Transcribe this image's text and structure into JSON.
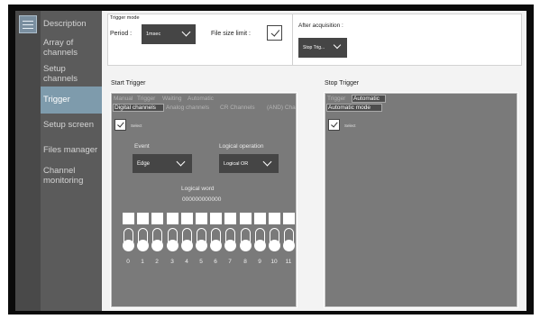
{
  "sidebar": {
    "menu_icon": "hamburger-menu-icon",
    "items": [
      {
        "label": "Description"
      },
      {
        "label": "Array of\nchannels"
      },
      {
        "label": "Setup\nchannels"
      },
      {
        "label": "Trigger",
        "active": true
      },
      {
        "label": "Setup screen"
      },
      {
        "label": "Files manager"
      },
      {
        "label": "Channel\nmonitoring"
      }
    ]
  },
  "trigger_mode": {
    "title": "Trigger mode",
    "period_label": "Period :",
    "period_value": "1msec",
    "file_size_label": "File size limit :",
    "file_size_checked": true,
    "after_acq_label": "After acquisition :",
    "after_acq_value": "Stop Trig..."
  },
  "start_trigger": {
    "title": "Start Trigger",
    "mode_tabs": [
      {
        "label": "Manual",
        "on": false
      },
      {
        "label": "Trigger",
        "on": false
      },
      {
        "label": "Waiting",
        "on": false
      },
      {
        "label": "Automatic",
        "on": false
      }
    ],
    "source_tabs": [
      {
        "label": "Digital channels",
        "on": true
      },
      {
        "label": "Analog channels",
        "on": false
      },
      {
        "label": "CR Channels",
        "on": false
      },
      {
        "label": "(AND) Chann",
        "on": false
      }
    ],
    "select_label": "Select",
    "select_checked": true,
    "event_label": "Event",
    "event_value": "Edge",
    "logic_label": "Logical operation",
    "logic_value": "Logical OR",
    "word_label": "Logical word",
    "word_value": "000000000000",
    "bits": [
      "0",
      "1",
      "2",
      "3",
      "4",
      "5",
      "6",
      "7",
      "8",
      "9",
      "10",
      "11"
    ]
  },
  "stop_trigger": {
    "title": "Stop Trigger",
    "tabs": [
      {
        "label": "Trigger",
        "on": false
      },
      {
        "label": "Automatic",
        "on": true
      }
    ],
    "mode_label": "Automatic mode",
    "select_label": "Select",
    "select_checked": true
  },
  "colors": {
    "sidebar": "#5b5b5b",
    "sidebar_active": "#7e9bac",
    "panel": "#7a7a7a",
    "select": "#454545"
  }
}
